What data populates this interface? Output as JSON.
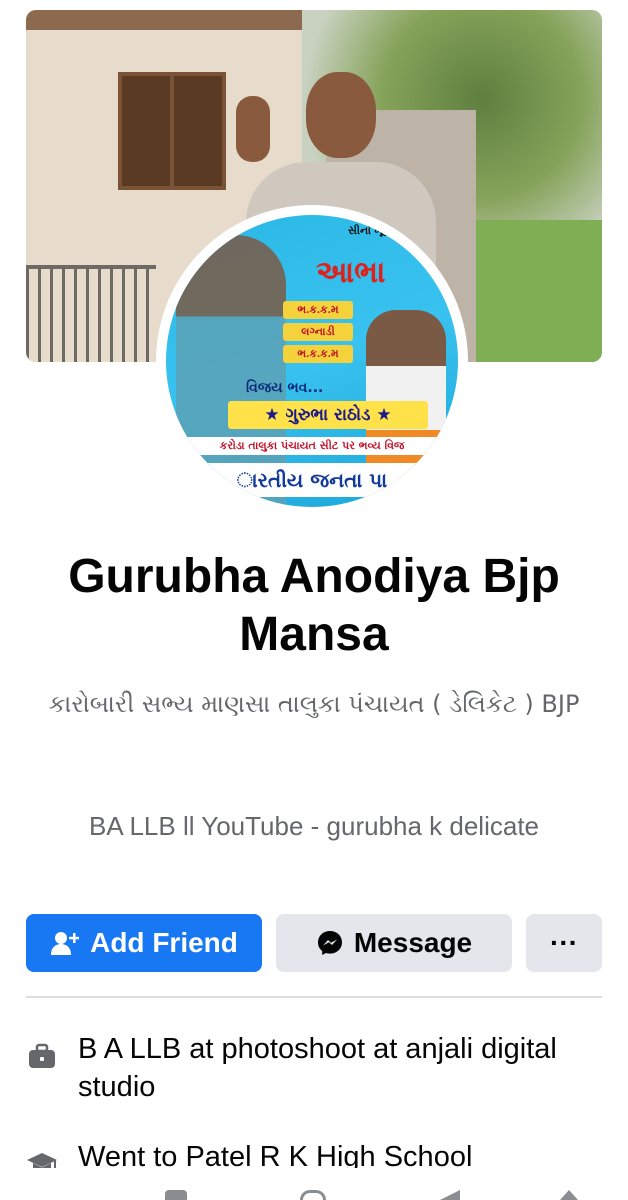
{
  "profile": {
    "name": "Gurubha Anodiya Bjp Mansa",
    "tagline": "કારોબારી સભ્ય માણસા તાલુકા પંચાયત ( ડેલિકેટ ) BJP",
    "bio": "BA LLB ll   YouTube - gurubha k delicate"
  },
  "avatar_poster": {
    "top_text": "સીનો ખૂબ ખૂ",
    "headline": "આભા",
    "chips": [
      "ભ.ક.ક.મ",
      "લગ્નાડી",
      "ભ.ક.ક.મ"
    ],
    "wish": "વિજય ભવ...",
    "name_band": "★ ગુરુભા રાઠોડ ★",
    "sub_band": "કરોડા તાલુકા પંચાયત સીટ પર ભવ્ય વિજ",
    "party_band": "ારતીય જનતા પા"
  },
  "actions": {
    "add_friend": "Add Friend",
    "message": "Message",
    "more": "···"
  },
  "info": {
    "work": "B A LLB at photoshoot at anjali digital studio",
    "education": "Went to Patel R K High School"
  },
  "colors": {
    "primary": "#1877f2",
    "secondary_bg": "#e4e6eb",
    "muted_text": "#65676b"
  },
  "icons": {
    "add_friend": "person-plus-icon",
    "message": "messenger-icon",
    "work": "briefcase-icon",
    "education": "graduation-cap-icon"
  }
}
